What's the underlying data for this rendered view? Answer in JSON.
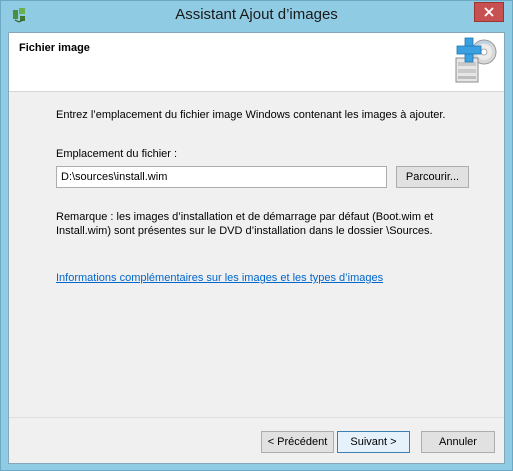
{
  "window": {
    "title": "Assistant Ajout d’images"
  },
  "header": {
    "title": "Fichier image",
    "icon": "add-image-disc-icon"
  },
  "main": {
    "instruction": "Entrez l’emplacement du fichier image Windows contenant les images à ajouter.",
    "path_label": "Emplacement du fichier :",
    "path_value": "D:\\sources\\install.wim",
    "browse_label": "Parcourir...",
    "note_line1": "Remarque : les images d’installation et de démarrage par défaut (Boot.wim et",
    "note_line2": "Install.wim) sont présentes sur le DVD d’installation dans le dossier \\Sources.",
    "info_link": "Informations complémentaires sur les images et les types d’images"
  },
  "footer": {
    "back_label": "< Précédent",
    "next_label": "Suivant >",
    "cancel_label": "Annuler"
  },
  "colors": {
    "titlebar": "#90cbe4",
    "close_button": "#c75050",
    "link": "#0066cc"
  }
}
